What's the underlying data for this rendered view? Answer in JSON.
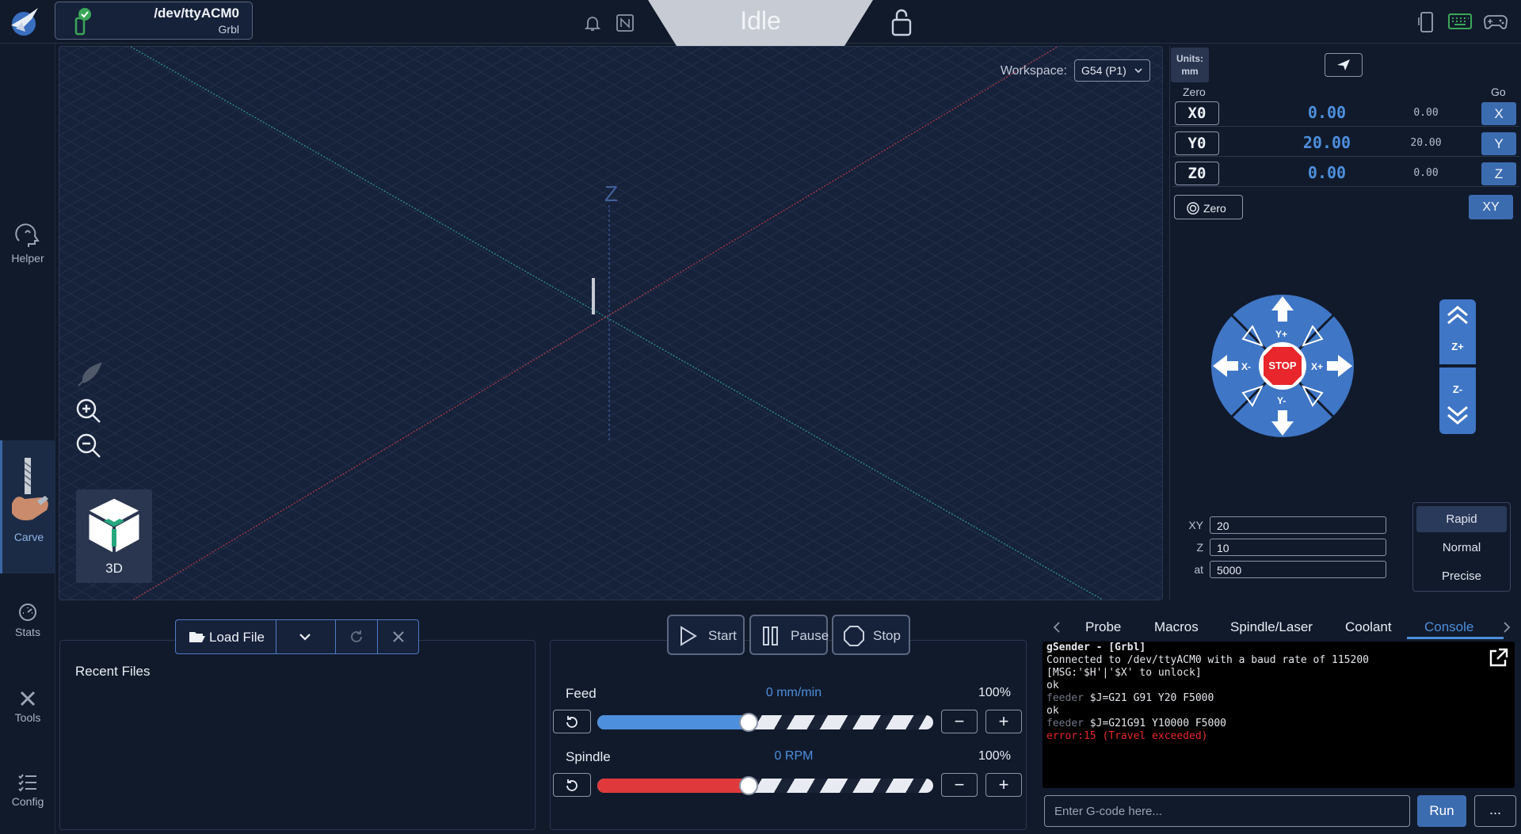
{
  "header": {
    "device_port": "/dev/ttyACM0",
    "device_firmware": "Grbl",
    "state": "Idle"
  },
  "sidebar": {
    "items": [
      {
        "label": "Helper",
        "icon": "helper-icon"
      },
      {
        "label": "Carve",
        "icon": "carve-icon",
        "active": true
      },
      {
        "label": "Stats",
        "icon": "stats-icon"
      },
      {
        "label": "Tools",
        "icon": "tools-icon"
      },
      {
        "label": "Config",
        "icon": "config-icon"
      }
    ]
  },
  "visualizer": {
    "workspace_label": "Workspace:",
    "workspace_value": "G54 (P1)",
    "z_axis_label": "Z",
    "view_label": "3D"
  },
  "position": {
    "units_label": "Units:",
    "units_value": "mm",
    "zero_header": "Zero",
    "go_header": "Go",
    "axes": [
      {
        "zero": "X0",
        "work": "0.00",
        "machine": "0.00",
        "go": "X"
      },
      {
        "zero": "Y0",
        "work": "20.00",
        "machine": "20.00",
        "go": "Y"
      },
      {
        "zero": "Z0",
        "work": "0.00",
        "machine": "0.00",
        "go": "Z"
      }
    ],
    "zero_all_label": "Zero",
    "go_xy_label": "XY"
  },
  "jog": {
    "labels": {
      "y_plus": "Y+",
      "y_minus": "Y-",
      "x_plus": "X+",
      "x_minus": "X-",
      "stop": "STOP",
      "z_plus": "Z+",
      "z_minus": "Z-"
    },
    "xy_label": "XY",
    "xy_value": "20",
    "z_label": "Z",
    "z_value": "10",
    "at_label": "at",
    "at_value": "5000",
    "speeds": [
      "Rapid",
      "Normal",
      "Precise"
    ],
    "selected_speed": "Rapid"
  },
  "files": {
    "load_label": "Load File",
    "recent_title": "Recent Files"
  },
  "run": {
    "start_label": "Start",
    "pause_label": "Pause",
    "stop_label": "Stop",
    "feed_label": "Feed",
    "feed_value": "0 mm/min",
    "feed_percent": "100%",
    "feed_fraction": 0.45,
    "spindle_label": "Spindle",
    "spindle_value": "0 RPM",
    "spindle_percent": "100%",
    "spindle_fraction": 0.45
  },
  "console": {
    "tabs": [
      "Probe",
      "Macros",
      "Spindle/Laser",
      "Coolant",
      "Console"
    ],
    "active_tab": "Console",
    "lines": [
      {
        "prefix": "",
        "text": "gSender - [Grbl]"
      },
      {
        "prefix": "",
        "text": "Connected to /dev/ttyACM0 with a baud rate of 115200"
      },
      {
        "prefix": "",
        "text": "[MSG:'$H'|'$X' to unlock]"
      },
      {
        "prefix": "",
        "text": "ok"
      },
      {
        "prefix": "feeder",
        "text": " $J=G21 G91 Y20 F5000"
      },
      {
        "prefix": "",
        "text": "ok"
      },
      {
        "prefix": "feeder",
        "text": " $J=G21G91 Y10000 F5000"
      },
      {
        "prefix": "",
        "text": "error:15 (Travel exceeded)",
        "error": true
      }
    ],
    "input_placeholder": "Enter G-code here...",
    "run_label": "Run",
    "more_label": "..."
  },
  "colors": {
    "background": "#111a2b",
    "accent": "#3c6cb0",
    "value_blue": "#4d8fdc",
    "stop_red": "#e8262b",
    "spindle_red": "#e0393c"
  }
}
